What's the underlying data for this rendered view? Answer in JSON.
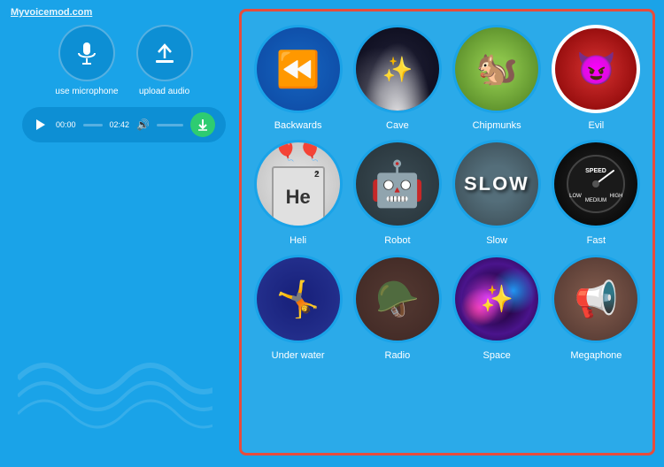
{
  "logo": {
    "text": "Myvoicemod.com"
  },
  "player": {
    "play_label": "▶",
    "time_start": "00:00",
    "time_end": "02:42",
    "progress": 0
  },
  "controls": {
    "mic_label": "use microphone",
    "upload_label": "upload audio"
  },
  "effects": [
    {
      "id": "backwards",
      "label": "Backwards",
      "selected": false
    },
    {
      "id": "cave",
      "label": "Cave",
      "selected": false
    },
    {
      "id": "chipmunks",
      "label": "Chipmunks",
      "selected": false
    },
    {
      "id": "evil",
      "label": "Evil",
      "selected": false
    },
    {
      "id": "heli",
      "label": "Heli",
      "selected": false
    },
    {
      "id": "robot",
      "label": "Robot",
      "selected": false
    },
    {
      "id": "slow",
      "label": "Slow",
      "selected": false
    },
    {
      "id": "fast",
      "label": "Fast",
      "selected": false
    },
    {
      "id": "underwater",
      "label": "Under water",
      "selected": false
    },
    {
      "id": "radio",
      "label": "Radio",
      "selected": false
    },
    {
      "id": "space",
      "label": "Space",
      "selected": false
    },
    {
      "id": "megaphone",
      "label": "Megaphone",
      "selected": false
    }
  ]
}
